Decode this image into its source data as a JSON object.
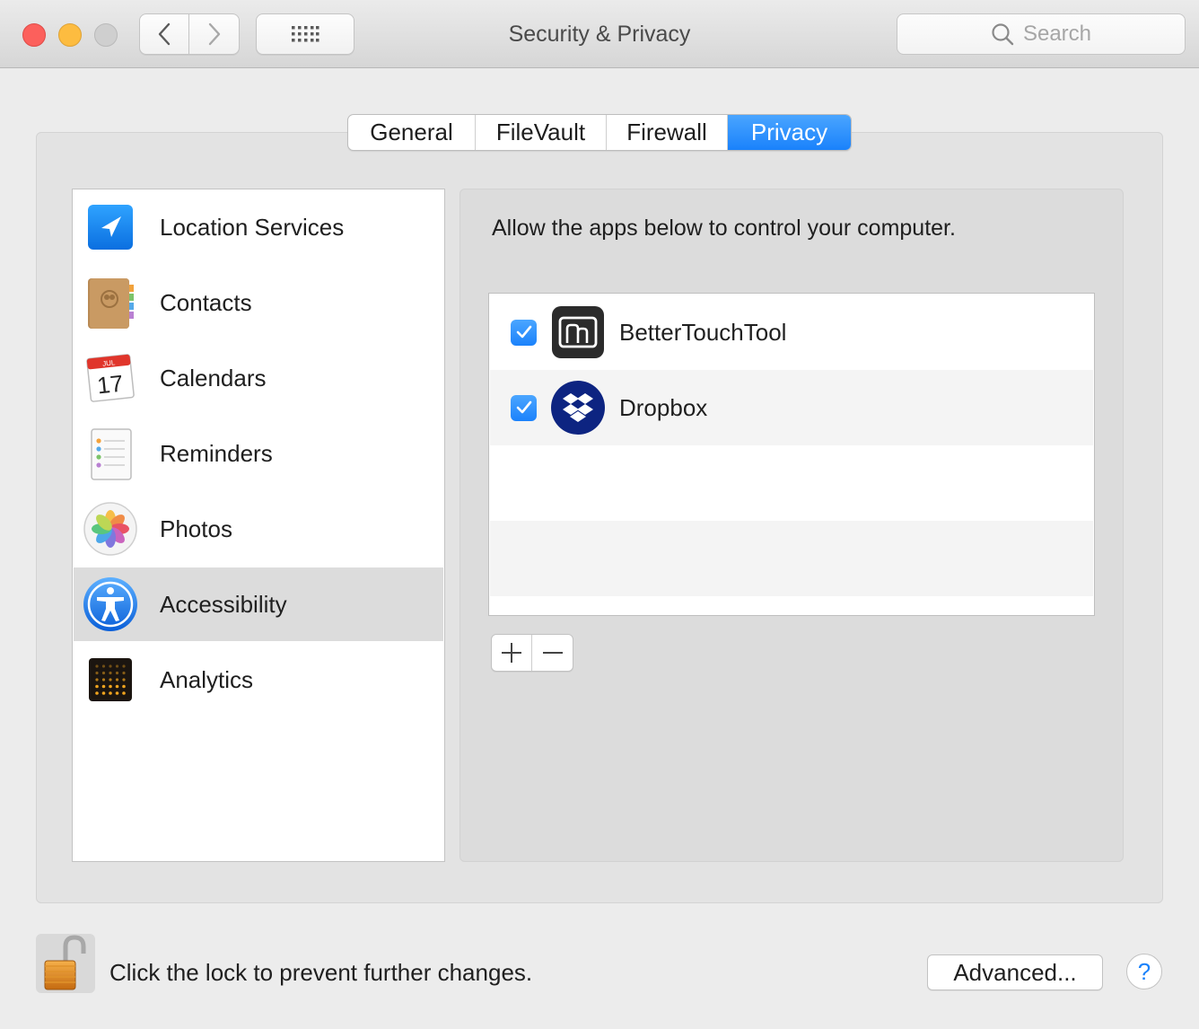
{
  "window": {
    "title": "Security & Privacy",
    "search_placeholder": "Search"
  },
  "tabs": [
    {
      "label": "General",
      "active": false
    },
    {
      "label": "FileVault",
      "active": false
    },
    {
      "label": "Firewall",
      "active": false
    },
    {
      "label": "Privacy",
      "active": true
    }
  ],
  "sidebar": {
    "items": [
      {
        "label": "Location Services",
        "icon": "location-arrow-icon"
      },
      {
        "label": "Contacts",
        "icon": "contacts-book-icon"
      },
      {
        "label": "Calendars",
        "icon": "calendar-icon",
        "calendar_month": "JUL",
        "calendar_day": "17"
      },
      {
        "label": "Reminders",
        "icon": "reminders-icon"
      },
      {
        "label": "Photos",
        "icon": "photos-flower-icon"
      },
      {
        "label": "Accessibility",
        "icon": "accessibility-icon",
        "selected": true
      },
      {
        "label": "Analytics",
        "icon": "analytics-dots-icon"
      }
    ]
  },
  "panel": {
    "heading": "Allow the apps below to control your computer.",
    "apps": [
      {
        "name": "BetterTouchTool",
        "checked": true,
        "icon": "bettertouchtool-icon"
      },
      {
        "name": "Dropbox",
        "checked": true,
        "icon": "dropbox-icon"
      }
    ],
    "add_symbol": "+",
    "remove_symbol": "—"
  },
  "footer": {
    "lock_text": "Click the lock to prevent further changes.",
    "advanced_label": "Advanced...",
    "help_label": "?"
  },
  "colors": {
    "accent": "#1a82fb",
    "close": "#fc605c",
    "minimize": "#fdbc40",
    "zoom_disabled": "#cfcfcf"
  }
}
